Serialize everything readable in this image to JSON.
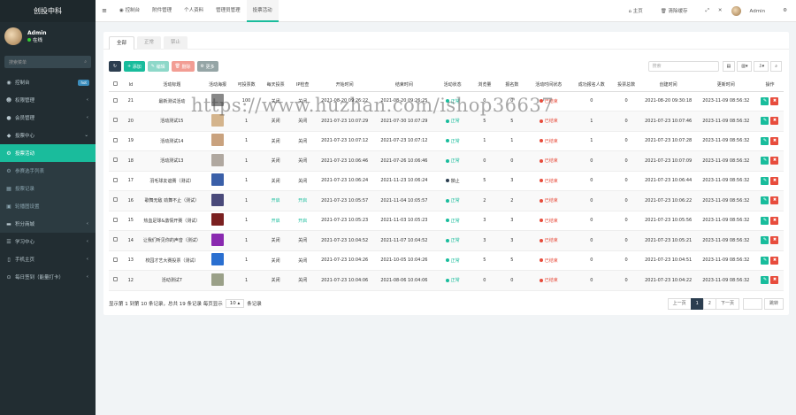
{
  "app_title": "创投中科",
  "user": {
    "name": "Admin",
    "status": "在线"
  },
  "sidebar_search_placeholder": "搜索菜单",
  "sidebar": [
    {
      "label": "控制台",
      "icon": "dashboard-icon",
      "badge": "hot"
    },
    {
      "label": "权限管理",
      "icon": "users-icon",
      "arrow": "‹"
    },
    {
      "label": "会员管理",
      "icon": "user-icon",
      "arrow": "‹"
    },
    {
      "label": "投票中心",
      "icon": "vote-icon",
      "arrow": "⌄"
    },
    {
      "label": "投票活动",
      "icon": "gear-icon",
      "active": true
    },
    {
      "label": "参赛选手列表",
      "icon": "gear-icon",
      "sub": true
    },
    {
      "label": "投票记录",
      "icon": "file-icon",
      "sub": true
    },
    {
      "label": "轮播图设置",
      "icon": "image-icon",
      "sub": true
    },
    {
      "label": "积分商城",
      "icon": "shop-icon",
      "arrow": "‹",
      "dark": true
    },
    {
      "label": "学习中心",
      "icon": "book-icon",
      "arrow": "‹"
    },
    {
      "label": "手机主页",
      "icon": "mobile-icon",
      "arrow": "‹"
    },
    {
      "label": "每日签到（能量打卡）",
      "icon": "toggle-icon",
      "arrow": "‹"
    }
  ],
  "top_tabs": [
    {
      "label": "控制台",
      "icon": "dashboard-icon"
    },
    {
      "label": "附件管理"
    },
    {
      "label": "个人资料"
    },
    {
      "label": "管理员管理"
    },
    {
      "label": "投票活动",
      "active": true
    }
  ],
  "top_right": {
    "home": "主页",
    "clear": "清除缓存",
    "user": "Admin"
  },
  "panel_tabs": [
    {
      "label": "全部",
      "active": true
    },
    {
      "label": "正常"
    },
    {
      "label": "禁止"
    }
  ],
  "toolbar": {
    "add": "添加",
    "edit": "编辑",
    "delete": "删除",
    "more": "更多",
    "search_placeholder": "搜索"
  },
  "columns": [
    "Id",
    "活动标题",
    "活动海报",
    "可投票数",
    "每天投票",
    "IP检查",
    "开始时间",
    "结束时间",
    "活动状态",
    "浏览量",
    "报名数",
    "活动时间状态",
    "成功报名人数",
    "投票总数",
    "创建时间",
    "更新时间",
    "操作"
  ],
  "rows": [
    {
      "id": "21",
      "title": "最新测试活动",
      "poster": "#888888",
      "votes": "100",
      "daily": "关闭",
      "ip": "关闭",
      "start": "2021-08-20 09:26:22",
      "end": "2021-08-20 09:26:25",
      "status": "正常",
      "status_type": "on",
      "views": "0",
      "signups": "0",
      "time_status": "已结束",
      "success": "0",
      "total": "0",
      "created": "2021-08-20 09:30:18",
      "updated": "2023-11-09 08:56:32"
    },
    {
      "id": "20",
      "title": "活动测试15",
      "poster": "#d4b48c",
      "votes": "1",
      "daily": "关闭",
      "ip": "关闭",
      "start": "2021-07-23 10:07:29",
      "end": "2021-07-30 10:07:29",
      "status": "正常",
      "status_type": "on",
      "views": "5",
      "signups": "5",
      "time_status": "已结束",
      "success": "1",
      "total": "0",
      "created": "2021-07-23 10:07:46",
      "updated": "2023-11-09 08:56:32"
    },
    {
      "id": "19",
      "title": "活动测试14",
      "poster": "#c9a27e",
      "votes": "1",
      "daily": "关闭",
      "ip": "关闭",
      "start": "2021-07-23 10:07:12",
      "end": "2021-07-23 10:07:12",
      "status": "正常",
      "status_type": "on",
      "views": "1",
      "signups": "1",
      "time_status": "已结束",
      "success": "1",
      "total": "0",
      "created": "2021-07-23 10:07:28",
      "updated": "2023-11-09 08:56:32"
    },
    {
      "id": "18",
      "title": "活动测试13",
      "poster": "#b0a8a0",
      "votes": "1",
      "daily": "关闭",
      "ip": "关闭",
      "start": "2021-07-23 10:06:46",
      "end": "2021-07-26 10:06:46",
      "status": "正常",
      "status_type": "on",
      "views": "0",
      "signups": "0",
      "time_status": "已结束",
      "success": "0",
      "total": "0",
      "created": "2021-07-23 10:07:09",
      "updated": "2023-11-09 08:56:32"
    },
    {
      "id": "17",
      "title": "羽毛球友谊赛（测试）",
      "poster": "#3a5fa8",
      "votes": "1",
      "daily": "关闭",
      "ip": "关闭",
      "start": "2021-07-23 10:06:24",
      "end": "2021-11-23 10:06:24",
      "status": "禁止",
      "status_type": "ban",
      "views": "5",
      "signups": "3",
      "time_status": "已结束",
      "success": "0",
      "total": "0",
      "created": "2021-07-23 10:06:44",
      "updated": "2023-11-09 08:56:32"
    },
    {
      "id": "16",
      "title": "歌舞无敌 劲舞不止（测试）",
      "poster": "#4a4a7a",
      "votes": "1",
      "daily": "开启",
      "ip": "开启",
      "start": "2021-07-23 10:05:57",
      "end": "2021-11-04 10:05:57",
      "status": "正常",
      "status_type": "on",
      "views": "2",
      "signups": "2",
      "time_status": "已结束",
      "success": "0",
      "total": "0",
      "created": "2021-07-23 10:06:22",
      "updated": "2023-11-09 08:56:32"
    },
    {
      "id": "15",
      "title": "热血足球&激情开赛（测试）",
      "poster": "#7a2020",
      "votes": "1",
      "daily": "开启",
      "ip": "开启",
      "start": "2021-07-23 10:05:23",
      "end": "2021-11-03 10:05:23",
      "status": "正常",
      "status_type": "on",
      "views": "3",
      "signups": "3",
      "time_status": "已结束",
      "success": "0",
      "total": "0",
      "created": "2021-07-23 10:05:56",
      "updated": "2023-11-09 08:56:32"
    },
    {
      "id": "14",
      "title": "让我们听见你的声音（测试）",
      "poster": "#8a2ab0",
      "votes": "1",
      "daily": "关闭",
      "ip": "关闭",
      "start": "2021-07-23 10:04:52",
      "end": "2021-11-07 10:04:52",
      "status": "正常",
      "status_type": "on",
      "views": "3",
      "signups": "3",
      "time_status": "已结束",
      "success": "0",
      "total": "0",
      "created": "2021-07-23 10:05:21",
      "updated": "2023-11-09 08:56:32"
    },
    {
      "id": "13",
      "title": "校园才艺大赛投票（测试）",
      "poster": "#2a6fd0",
      "votes": "1",
      "daily": "关闭",
      "ip": "关闭",
      "start": "2021-07-23 10:04:26",
      "end": "2021-10-05 10:04:26",
      "status": "正常",
      "status_type": "on",
      "views": "5",
      "signups": "5",
      "time_status": "已结束",
      "success": "0",
      "total": "0",
      "created": "2021-07-23 10:04:51",
      "updated": "2023-11-09 08:56:32"
    },
    {
      "id": "12",
      "title": "活动测试7",
      "poster": "#9aa088",
      "votes": "1",
      "daily": "关闭",
      "ip": "关闭",
      "start": "2021-07-23 10:04:06",
      "end": "2021-08-06 10:04:06",
      "status": "正常",
      "status_type": "on",
      "views": "0",
      "signups": "0",
      "time_status": "已结束",
      "success": "0",
      "total": "0",
      "created": "2021-07-23 10:04:22",
      "updated": "2023-11-09 08:56:32"
    }
  ],
  "footer": {
    "summary": "显示第 1 到第 10 条记录，总共 19 条记录 每页显示",
    "page_size": "10",
    "suffix": "条记录"
  },
  "pager": {
    "prev": "上一页",
    "pages": [
      "1",
      "2"
    ],
    "next": "下一页",
    "jump": "跳转"
  },
  "watermark": "https://www.huzhan.com/ishop36637"
}
